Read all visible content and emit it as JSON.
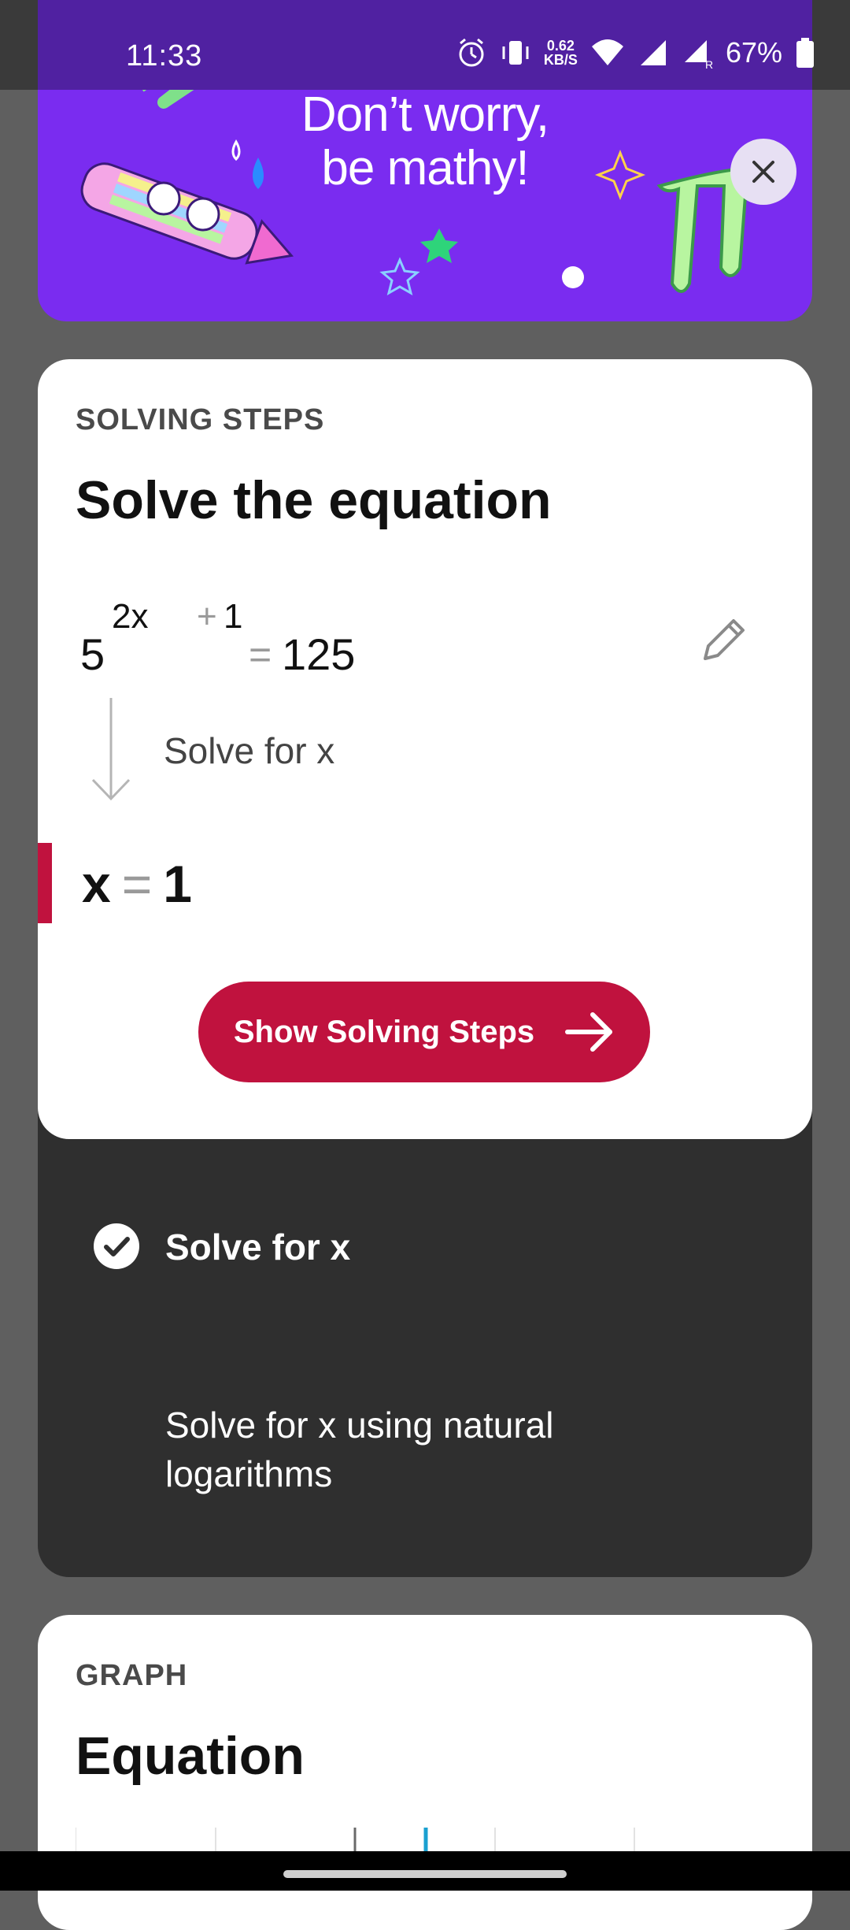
{
  "status_bar": {
    "time": "11:33",
    "speed_value": "0.62",
    "speed_unit": "KB/S",
    "battery": "67%",
    "icons": [
      "alarm-icon",
      "vibrate-icon",
      "wifi-icon",
      "signal-icon",
      "signal-r-icon",
      "battery-icon"
    ]
  },
  "banner": {
    "line1": "Don’t worry,",
    "line2": "be mathy!",
    "close_icon": "close-icon",
    "bg_color": "#7a2cf0"
  },
  "solving": {
    "section_label": "SOLVING STEPS",
    "title": "Solve the equation",
    "equation": {
      "base": "5",
      "exp_coeff": "2x",
      "exp_plus": "+",
      "exp_const": "1",
      "equals": "=",
      "rhs": "125"
    },
    "step_label": "Solve for x",
    "answer": {
      "var": "x",
      "equals": "=",
      "value": "1"
    },
    "button_label": "Show Solving Steps",
    "accent_color": "#c0123e"
  },
  "methods": {
    "title": "Solve for x",
    "description": "Solve for x using natural logarithms"
  },
  "graph": {
    "section_label": "GRAPH",
    "title": "Equation"
  }
}
